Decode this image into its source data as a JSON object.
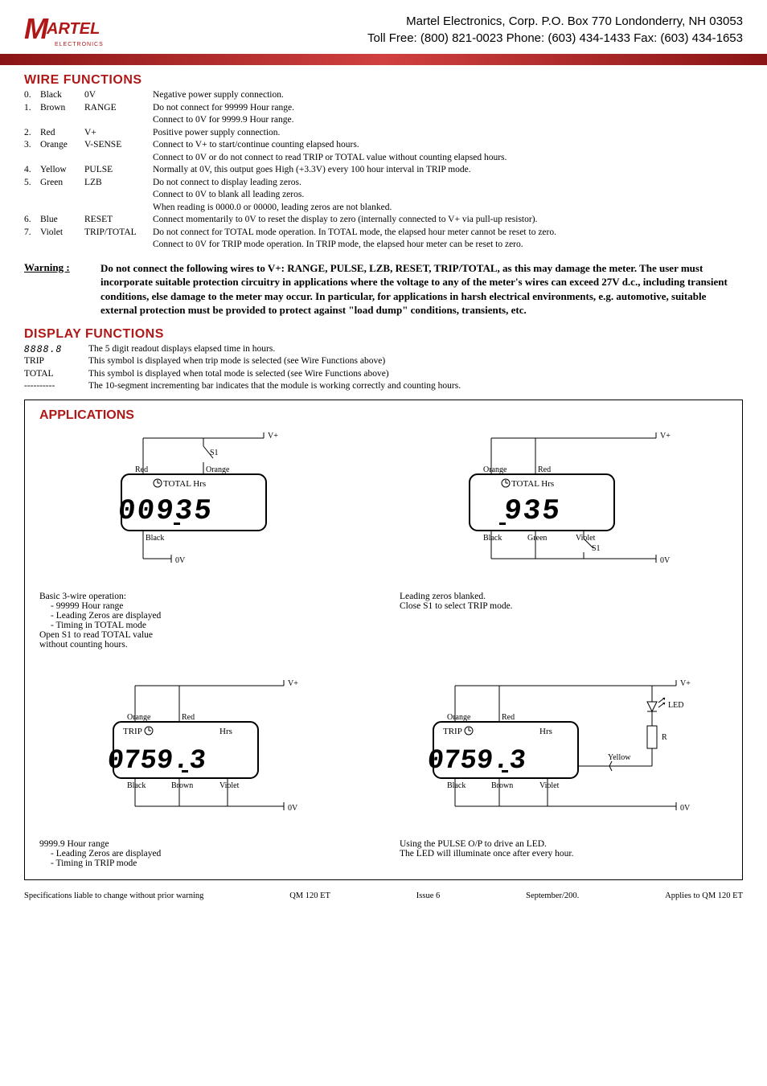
{
  "header": {
    "logo_main": "M",
    "logo_text": "ARTEL",
    "logo_sub": "ELECTRONICS",
    "line1": "Martel Electronics, Corp.  P.O. Box 770  Londonderry, NH 03053",
    "line2": "Toll Free: (800) 821-0023  Phone: (603) 434-1433  Fax: (603) 434-1653"
  },
  "sections": {
    "wire_title": "WIRE FUNCTIONS",
    "wires": [
      {
        "n": "0.",
        "c": "Black",
        "s": "0V",
        "d": [
          "Negative power supply connection."
        ]
      },
      {
        "n": "1.",
        "c": "Brown",
        "s": "RANGE",
        "d": [
          "Do not connect for 99999 Hour range.",
          "Connect to 0V for 9999.9 Hour range."
        ]
      },
      {
        "n": "2.",
        "c": "Red",
        "s": "V+",
        "d": [
          "Positive power supply connection."
        ]
      },
      {
        "n": "3.",
        "c": "Orange",
        "s": "V-SENSE",
        "d": [
          "Connect to V+ to start/continue counting elapsed hours.",
          "Connect to 0V or do not connect to read TRIP or TOTAL value without counting elapsed hours."
        ]
      },
      {
        "n": "4.",
        "c": "Yellow",
        "s": "PULSE",
        "d": [
          "Normally at 0V, this output goes High (+3.3V) every 100 hour interval in TRIP mode."
        ]
      },
      {
        "n": "5.",
        "c": "Green",
        "s": "LZB",
        "d": [
          "Do not connect to display leading zeros.",
          "Connect to 0V to blank all leading zeros.",
          "When reading is 0000.0 or 00000, leading zeros are not blanked."
        ]
      },
      {
        "n": "6.",
        "c": "Blue",
        "s": "RESET",
        "d": [
          "Connect momentarily to  0V to reset the display to zero (internally connected to V+ via pull-up resistor)."
        ]
      },
      {
        "n": "7.",
        "c": "Violet",
        "s": "TRIP/TOTAL",
        "d": [
          "Do not connect for TOTAL mode operation. In TOTAL mode, the elapsed hour meter cannot be reset to zero.",
          "Connect to 0V for TRIP mode operation. In TRIP mode, the elapsed hour meter can be reset to zero."
        ]
      }
    ],
    "warning_label": "Warning :",
    "warning_text": "Do not connect the following wires to V+: RANGE, PULSE, LZB, RESET, TRIP/TOTAL, as this may damage the meter.  The user must incorporate suitable protection circuitry in applications where the voltage to any of the meter's wires can exceed 27V d.c., including transient conditions, else damage to the meter may occur. In particular, for applications in harsh electrical environments, e.g. automotive, suitable external protection must be provided to protect against \"load dump\" conditions, transients, etc.",
    "display_title": "DISPLAY FUNCTIONS",
    "display_rows": [
      {
        "k": "8888.8",
        "v": "The 5 digit readout displays elapsed time in hours.",
        "seg": true
      },
      {
        "k": "TRIP",
        "v": "This symbol is displayed when trip mode is selected (see Wire Functions above)"
      },
      {
        "k": "TOTAL",
        "v": "This symbol is displayed when total mode is selected (see Wire Functions above)"
      },
      {
        "k": "----------",
        "v": "The 10-segment incrementing bar indicates that the module is working correctly and counting hours."
      }
    ],
    "apps_title": "APPLICATIONS",
    "diagrams": {
      "d1": {
        "lcd_top": "TOTAL Hrs",
        "lcd_val": "00935",
        "labels": {
          "vp": "V+",
          "red": "Red",
          "orange": "Orange",
          "black": "Black",
          "zero": "0V",
          "s1": "S1"
        },
        "caption": [
          "Basic 3-wire operation:",
          " - 99999 Hour range",
          " - Leading Zeros are displayed",
          " - Timing in TOTAL mode",
          "Open S1 to read TOTAL value",
          "without counting hours."
        ]
      },
      "d2": {
        "lcd_top": "TOTAL Hrs",
        "lcd_val": "  935",
        "labels": {
          "vp": "V+",
          "red": "Red",
          "orange": "Orange",
          "black": "Black",
          "green": "Green",
          "violet": "Violet",
          "zero": "0V",
          "s1": "S1"
        },
        "caption": [
          "Leading zeros blanked.",
          "Close S1 to select TRIP mode."
        ]
      },
      "d3": {
        "lcd_top_l": "TRIP",
        "lcd_top_r": "Hrs",
        "lcd_val": "0759.3",
        "labels": {
          "vp": "V+",
          "red": "Red",
          "orange": "Orange",
          "black": "Black",
          "brown": "Brown",
          "violet": "Violet",
          "zero": "0V"
        },
        "caption": [
          "9999.9 Hour range",
          " - Leading Zeros are displayed",
          " - Timing in TRIP mode"
        ]
      },
      "d4": {
        "lcd_top_l": "TRIP",
        "lcd_top_r": "Hrs",
        "lcd_val": "0759.3",
        "labels": {
          "vp": "V+",
          "red": "Red",
          "orange": "Orange",
          "black": "Black",
          "brown": "Brown",
          "violet": "Violet",
          "yellow": "Yellow",
          "zero": "0V",
          "led": "LED",
          "r": "R"
        },
        "caption": [
          "Using the PULSE O/P to drive an LED.",
          "The LED will illuminate once after every hour."
        ]
      }
    }
  },
  "footer": {
    "left": "Specifications liable to change without prior warning",
    "mid1": "QM 120 ET",
    "mid2": "Issue 6",
    "mid3": "September/200.",
    "right": "Applies to QM 120 ET"
  }
}
